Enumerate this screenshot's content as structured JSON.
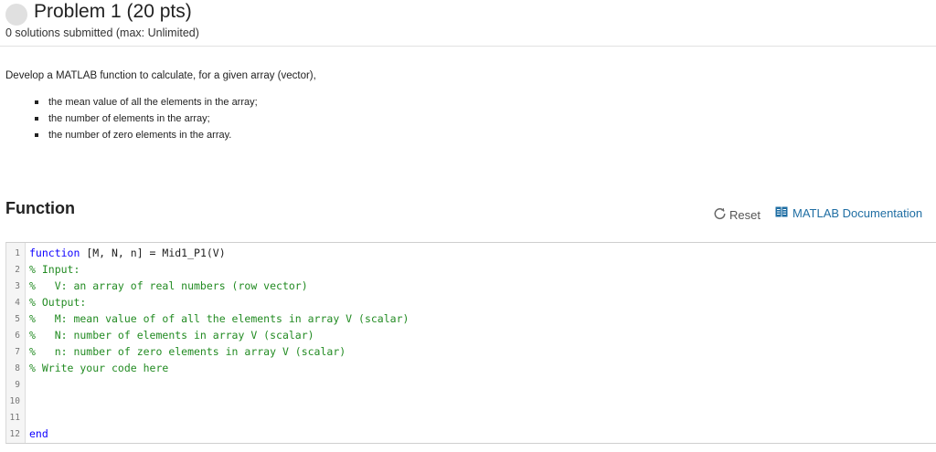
{
  "header": {
    "title": "Problem 1 (20 pts)",
    "submissions": "0 solutions submitted (max: Unlimited)"
  },
  "problem": {
    "description": "Develop a MATLAB function to calculate, for a given array (vector),",
    "bullets": [
      "the mean value of all the elements in the array;",
      "the number of elements in the array;",
      "the number of zero elements in the array."
    ]
  },
  "function_section": {
    "heading": "Function",
    "reset_label": "Reset",
    "doc_label": "MATLAB Documentation"
  },
  "editor": {
    "line_numbers": [
      "1",
      "2",
      "3",
      "4",
      "5",
      "6",
      "7",
      "8",
      "9",
      "10",
      "11",
      "12"
    ],
    "lines": [
      {
        "kw": "function",
        "text": " [M, N, n] = Mid1_P1(V)"
      },
      {
        "cm": "% Input:"
      },
      {
        "cm": "%   V: an array of real numbers (row vector)"
      },
      {
        "cm": "% Output:"
      },
      {
        "cm": "%   M: mean value of of all the elements in array V (scalar)"
      },
      {
        "cm": "%   N: number of elements in array V (scalar)"
      },
      {
        "cm": "%   n: number of zero elements in array V (scalar)"
      },
      {
        "cm": "% Write your code here"
      },
      {
        "text": ""
      },
      {
        "text": ""
      },
      {
        "text": ""
      },
      {
        "kw": "end"
      }
    ]
  },
  "colors": {
    "keyword": "#0e00ff",
    "comment": "#228b22",
    "link": "#1f6ea3"
  }
}
